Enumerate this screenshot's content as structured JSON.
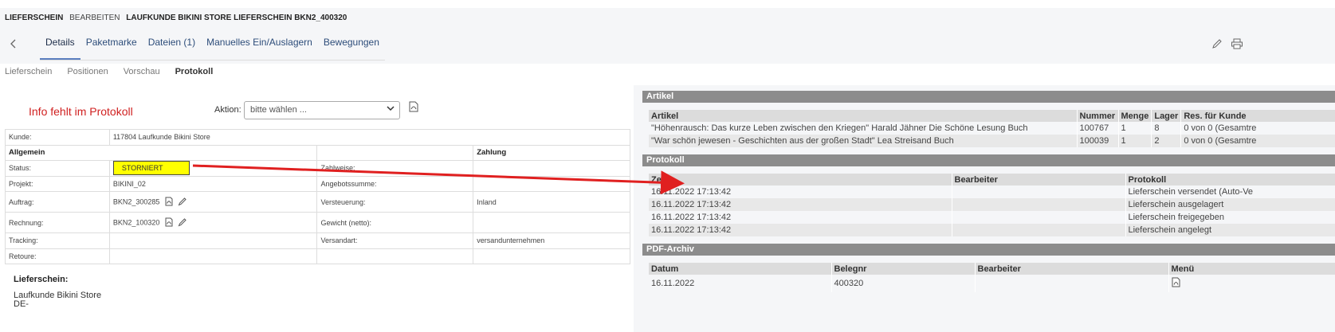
{
  "header": {
    "crumb_doc": "LIEFERSCHEIN",
    "crumb_action": "BEARBEITEN",
    "crumb_title": "LAUFKUNDE BIKINI STORE LIEFERSCHEIN BKN2_400320",
    "back_icon": "chevron-left-icon",
    "tabs": [
      {
        "label": "Details",
        "active": true
      },
      {
        "label": "Paketmarke"
      },
      {
        "label": "Dateien (1)"
      },
      {
        "label": "Manuelles Ein/Auslagern"
      },
      {
        "label": "Bewegungen"
      }
    ],
    "tools": [
      "pencil-icon",
      "printer-icon"
    ]
  },
  "subtabs": [
    {
      "label": "Lieferschein"
    },
    {
      "label": "Positionen"
    },
    {
      "label": "Vorschau"
    },
    {
      "label": "Protokoll",
      "active": true
    }
  ],
  "annotation": {
    "note": "Info fehlt im Protokoll",
    "arrow_color": "#e02020"
  },
  "aktion": {
    "label": "Aktion:",
    "placeholder": "bitte wählen ..."
  },
  "info": {
    "kunde_label": "Kunde:",
    "kunde_value": "117804 Laufkunde Bikini Store",
    "allgemein": "Allgemein",
    "zahlung": "Zahlung",
    "status_label": "Status:",
    "status_value": "STORNIERT",
    "status_color": "#ffff00",
    "zahlweise_label": "Zahlweise:",
    "projekt_label": "Projekt:",
    "projekt_value": "BIKINI_02",
    "angebotssumme_label": "Angebotssumme:",
    "auftrag_label": "Auftrag:",
    "auftrag_value": "BKN2_300285",
    "versteuerung_label": "Versteuerung:",
    "versteuerung_value": "Inland",
    "rechnung_label": "Rechnung:",
    "rechnung_value": "BKN2_100320",
    "gewicht_label": "Gewicht (netto):",
    "tracking_label": "Tracking:",
    "versandart_label": "Versandart:",
    "versandart_value": "versandunternehmen",
    "retoure_label": "Retoure:"
  },
  "lieferschein": {
    "title": "Lieferschein:",
    "line1": "Laufkunde Bikini Store",
    "line2": "DE-"
  },
  "artikel": {
    "title": "Artikel",
    "columns": [
      "Artikel",
      "Nummer",
      "Menge",
      "Lager",
      "Res. für Kunde"
    ],
    "rows": [
      [
        "\"Höhenrausch: Das kurze Leben zwischen den Kriegen\" Harald Jähner Die Schöne Lesung Buch",
        "100767",
        "1",
        "8",
        "0 von 0 (Gesamtre"
      ],
      [
        "\"War schön jewesen - Geschichten aus der großen Stadt\" Lea Streisand Buch",
        "100039",
        "1",
        "2",
        "0 von 0 (Gesamtre"
      ]
    ]
  },
  "protokoll": {
    "title": "Protokoll",
    "columns": [
      "Zeit",
      "Bearbeiter",
      "Protokoll"
    ],
    "rows": [
      [
        "16.11.2022 17:13:42",
        "",
        "Lieferschein versendet (Auto-Ve"
      ],
      [
        "16.11.2022 17:13:42",
        "",
        "Lieferschein ausgelagert"
      ],
      [
        "16.11.2022 17:13:42",
        "",
        "Lieferschein freigegeben"
      ],
      [
        "16.11.2022 17:13:42",
        "",
        "Lieferschein angelegt"
      ]
    ]
  },
  "pdf_archiv": {
    "title": "PDF-Archiv",
    "columns": [
      "Datum",
      "Belegnr",
      "Bearbeiter",
      "Menü"
    ],
    "rows": [
      [
        "16.11.2022",
        "400320",
        "",
        ""
      ]
    ]
  }
}
